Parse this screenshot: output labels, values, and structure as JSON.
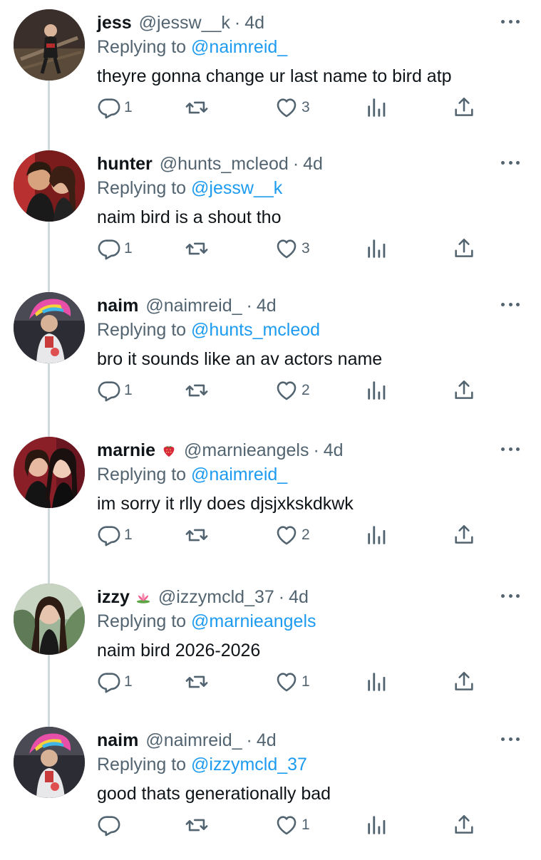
{
  "tweets": [
    {
      "name": "jess",
      "emoji": "",
      "handle": "@jessw__k",
      "time": "4d",
      "replying_label": "Replying to",
      "replying_to": "@naimreid_",
      "text": "theyre gonna change ur last name to bird atp",
      "replies": "1",
      "retweets": "",
      "likes": "3"
    },
    {
      "name": "hunter",
      "emoji": "",
      "handle": "@hunts_mcleod",
      "time": "4d",
      "replying_label": "Replying to",
      "replying_to": "@jessw__k",
      "text": "naim bird is a shout tho",
      "replies": "1",
      "retweets": "",
      "likes": "3"
    },
    {
      "name": "naim",
      "emoji": "",
      "handle": "@naimreid_",
      "time": "4d",
      "replying_label": "Replying to",
      "replying_to": "@hunts_mcleod",
      "text": "bro it sounds like an av actors name",
      "replies": "1",
      "retweets": "",
      "likes": "2"
    },
    {
      "name": "marnie",
      "emoji": "strawberry",
      "handle": "@marnieangels",
      "time": "4d",
      "replying_label": "Replying to",
      "replying_to": "@naimreid_",
      "text": "im sorry it rlly does djsjxkskdkwk",
      "replies": "1",
      "retweets": "",
      "likes": "2"
    },
    {
      "name": "izzy",
      "emoji": "lotus",
      "handle": "@izzymcld_37",
      "time": "4d",
      "replying_label": "Replying to",
      "replying_to": "@marnieangels",
      "text": "naim bird 2026-2026",
      "replies": "1",
      "retweets": "",
      "likes": "1"
    },
    {
      "name": "naim",
      "emoji": "",
      "handle": "@naimreid_",
      "time": "4d",
      "replying_label": "Replying to",
      "replying_to": "@izzymcld_37",
      "text": "good thats generationally bad",
      "replies": "",
      "retweets": "",
      "likes": "1"
    }
  ],
  "icons": {
    "reply": "reply-icon",
    "retweet": "retweet-icon",
    "like": "heart-icon",
    "views": "views-icon",
    "share": "share-icon",
    "more": "more-icon"
  },
  "colors": {
    "text": "#0f1419",
    "secondary": "#536471",
    "link": "#1d9bf0",
    "thread": "#cfd9de"
  }
}
